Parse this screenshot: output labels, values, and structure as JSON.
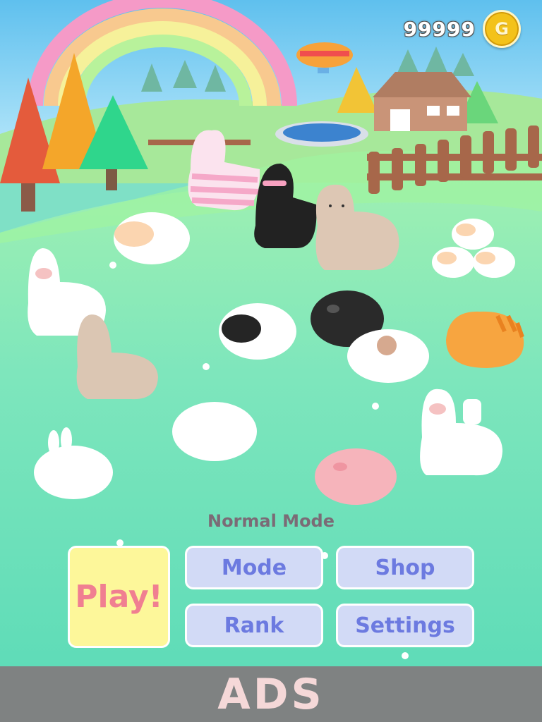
{
  "hud": {
    "coin_count": "99999",
    "coin_symbol": "G"
  },
  "menu": {
    "mode_label": "Normal Mode",
    "play_label": "Play!",
    "mode_label_btn": "Mode",
    "shop_label": "Shop",
    "rank_label": "Rank",
    "settings_label": "Settings"
  },
  "ads_label": "ADS",
  "colors": {
    "sky": "#6cc7ef",
    "grass": "#7fe0c6",
    "play_bg": "#fdf79a",
    "play_text": "#f07f91",
    "button_bg": "#d2daf6",
    "button_text": "#6c7ae0",
    "ads_bar": "#7f8282"
  },
  "scene_icons": [
    "rainbow",
    "blimp",
    "barn",
    "pond",
    "fence",
    "trees",
    "alpacas",
    "sheep",
    "pig",
    "cat",
    "bunny"
  ]
}
